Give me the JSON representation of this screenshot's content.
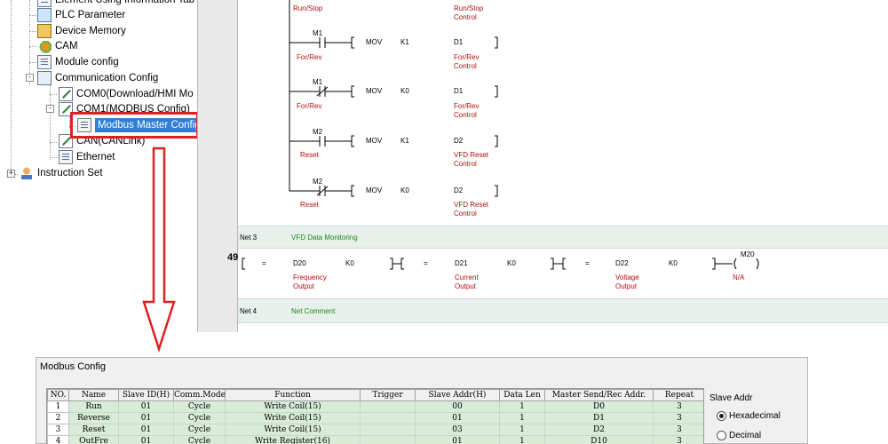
{
  "tree": {
    "items": [
      {
        "label": "Element Using Information Tab",
        "icon": "document-icon"
      },
      {
        "label": "PLC Parameter",
        "icon": "plc-parameter-icon"
      },
      {
        "label": "Device Memory",
        "icon": "device-memory-icon"
      },
      {
        "label": "CAM",
        "icon": "cam-icon"
      },
      {
        "label": "Module config",
        "icon": "module-config-icon"
      },
      {
        "label": "Communication Config",
        "icon": "communication-config-icon",
        "expander": "-"
      },
      {
        "label": "COM0(Download/HMI Mo",
        "icon": "com-port-icon"
      },
      {
        "label": "COM1(MODBUS Config)",
        "icon": "com-port-icon",
        "expander": "-"
      },
      {
        "label": "Modbus Master Config",
        "icon": "modbus-master-icon",
        "selected": true
      },
      {
        "label": "CAN(CANLink)",
        "icon": "com-port-icon"
      },
      {
        "label": "Ethernet",
        "icon": "ethernet-icon"
      },
      {
        "label": "Instruction Set",
        "icon": "instruction-set-icon",
        "expander": "+"
      }
    ]
  },
  "ladder": {
    "top_labels": {
      "left": "Run/Stop",
      "right_1": "Run/Stop",
      "right_2": "Control"
    },
    "rungs": [
      {
        "contact": "M1",
        "contact_type": "NO",
        "instr": "MOV",
        "src": "K1",
        "dst": "D1",
        "contact_comment": "For/Rev",
        "dst_comment_1": "For/Rev",
        "dst_comment_2": "Control"
      },
      {
        "contact": "M1",
        "contact_type": "NC",
        "instr": "MOV",
        "src": "K0",
        "dst": "D1",
        "contact_comment": "For/Rev",
        "dst_comment_1": "For/Rev",
        "dst_comment_2": "Control"
      },
      {
        "contact": "M2",
        "contact_type": "NO",
        "instr": "MOV",
        "src": "K1",
        "dst": "D2",
        "contact_comment": "Reset",
        "dst_comment_1": "VFD Reset",
        "dst_comment_2": "Control"
      },
      {
        "contact": "M2",
        "contact_type": "NC",
        "instr": "MOV",
        "src": "K0",
        "dst": "D2",
        "contact_comment": "Reset",
        "dst_comment_1": "VFD Reset",
        "dst_comment_2": "Control"
      }
    ],
    "net3": {
      "label": "Net 3",
      "comment": "VFD Data Monitoring"
    },
    "net4": {
      "label": "Net 4",
      "comment": "Net Comment"
    },
    "step": "49",
    "compare": [
      {
        "op": "=",
        "a": "D20",
        "b": "K0",
        "c1": "Frequency",
        "c2": "Output"
      },
      {
        "op": "=",
        "a": "D21",
        "b": "K0",
        "c1": "Current",
        "c2": "Output"
      },
      {
        "op": "=",
        "a": "D22",
        "b": "K0",
        "c1": "Voltage",
        "c2": "Output"
      }
    ],
    "coil": {
      "name": "M20",
      "comment": "N/A"
    }
  },
  "dialog": {
    "title": "Modbus Config",
    "columns": [
      "NO.",
      "Name",
      "Slave ID(H)",
      "Comm.Mode",
      "Function",
      "Trigger",
      "Slave Addr(H)",
      "Data Len",
      "Master Send/Rec Addr.",
      "Repeat"
    ],
    "rows": [
      [
        "1",
        "Run",
        "01",
        "Cycle",
        "Write Coil(15)",
        "",
        "00",
        "1",
        "D0",
        "3"
      ],
      [
        "2",
        "Reverse",
        "01",
        "Cycle",
        "Write Coil(15)",
        "",
        "01",
        "1",
        "D1",
        "3"
      ],
      [
        "3",
        "Reset",
        "01",
        "Cycle",
        "Write Coil(15)",
        "",
        "03",
        "1",
        "D2",
        "3"
      ],
      [
        "4",
        "OutFre",
        "01",
        "Cycle",
        "Write Register(16)",
        "",
        "01",
        "1",
        "D10",
        "3"
      ]
    ],
    "slave_addr_group": {
      "title": "Slave Addr",
      "options": [
        "Hexadecimal",
        "Decimal"
      ],
      "selected": "Hexadecimal"
    }
  },
  "colors": {
    "highlight": "#e02020",
    "selection": "#2f7fd8",
    "comment_red": "#b01010",
    "comment_green": "#1a8a1a",
    "row_green": "#d8ecd8"
  }
}
